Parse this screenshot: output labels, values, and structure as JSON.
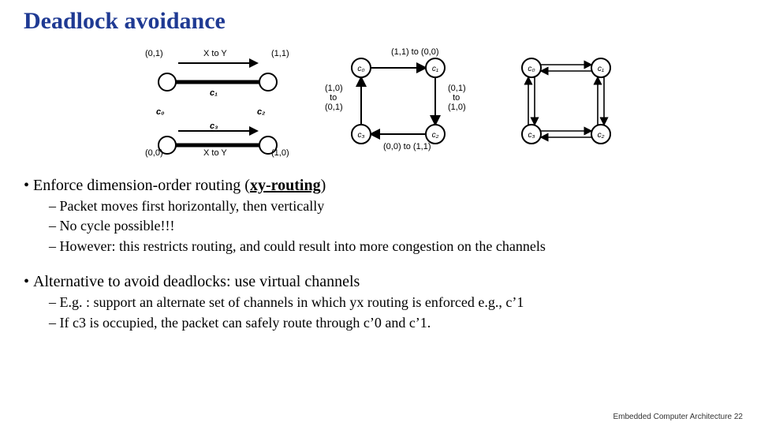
{
  "title": "Deadlock avoidance",
  "diagram1": {
    "tl": "(0,1)",
    "tr": "(1,1)",
    "bl": "(0,0)",
    "br": "(1,0)",
    "xtoy_top": "X to Y",
    "xtoy_bot": "X to Y",
    "c0": "c₀",
    "c1": "c₁",
    "c2": "c₂",
    "c3": "c₃"
  },
  "diagram2": {
    "top": "(1,1) to (0,0)",
    "left": "(1,0)\n  to\n(0,1)",
    "right": "(0,1)\n  to\n(1,0)",
    "bot": "(0,0) to (1,1)",
    "c0": "c₀",
    "c1": "c₁",
    "c2": "c₂",
    "c3": "c₃"
  },
  "diagram3": {
    "c0": "c₀",
    "c1": "c₁",
    "c2": "c₂",
    "c3": "c₃"
  },
  "bullets": {
    "a": "Enforce dimension-order routing (",
    "xy": "xy-routing",
    "a2": ")",
    "a_s1": "Packet moves first horizontally, then vertically",
    "a_s2": "No cycle possible!!!",
    "a_s3": "However: this restricts routing, and could result into more congestion on the channels",
    "b": "Alternative to avoid deadlocks: use virtual channels",
    "b_s1": "E.g. : support an alternate set of channels in which yx routing is enforced e.g., c’1",
    "b_s2": "If c3 is occupied, the packet can safely route through c’0 and c’1."
  },
  "footer": "Embedded Computer Architecture  22"
}
